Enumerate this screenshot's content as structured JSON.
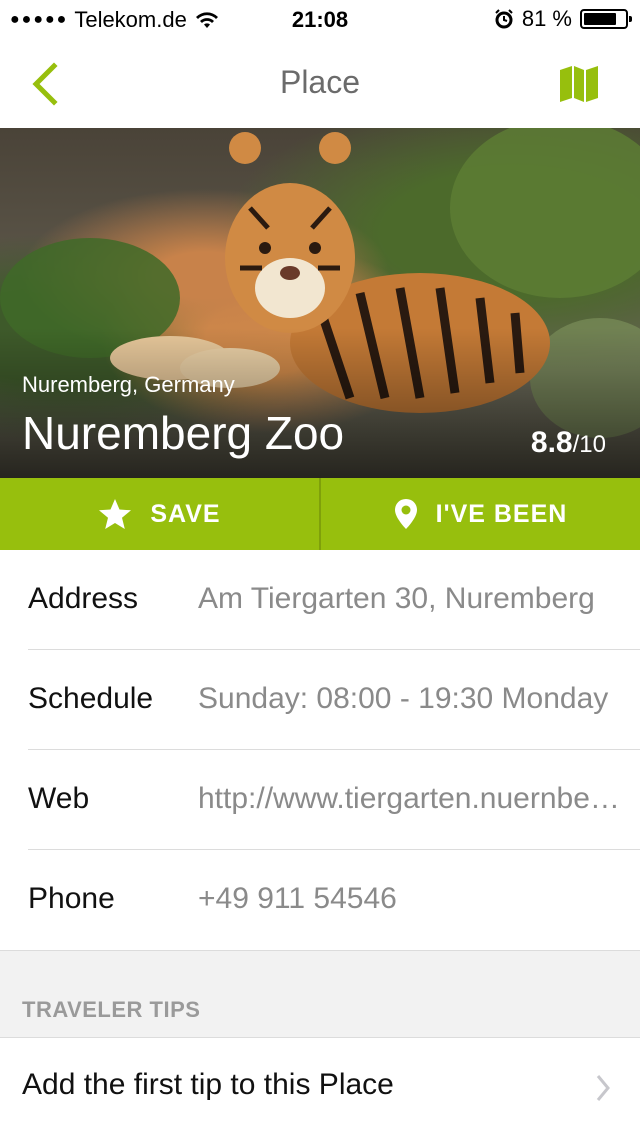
{
  "status_bar": {
    "signal_dots": "●●●●●",
    "carrier": "Telekom.de",
    "time": "21:08",
    "battery_percent": "81 %",
    "battery_level": 0.81
  },
  "navbar": {
    "title": "Place",
    "back_icon": "chevron-left-icon",
    "map_icon": "map-icon",
    "accent_color": "#97bf0d"
  },
  "hero": {
    "location": "Nuremberg, Germany",
    "name": "Nuremberg Zoo",
    "score": "8.8",
    "score_suffix": "/10"
  },
  "actions": {
    "save_label": "SAVE",
    "been_label": "I'VE BEEN"
  },
  "details": [
    {
      "label": "Address",
      "value": "Am Tiergarten 30, Nuremberg"
    },
    {
      "label": "Schedule",
      "value": "Sunday: 08:00 - 19:30 Monday"
    },
    {
      "label": "Web",
      "value": "http://www.tiergarten.nuernberg.de"
    },
    {
      "label": "Phone",
      "value": "+49 911 54546"
    }
  ],
  "tips": {
    "header": "TRAVELER TIPS",
    "add_tip_label": "Add the first tip to this Place"
  }
}
